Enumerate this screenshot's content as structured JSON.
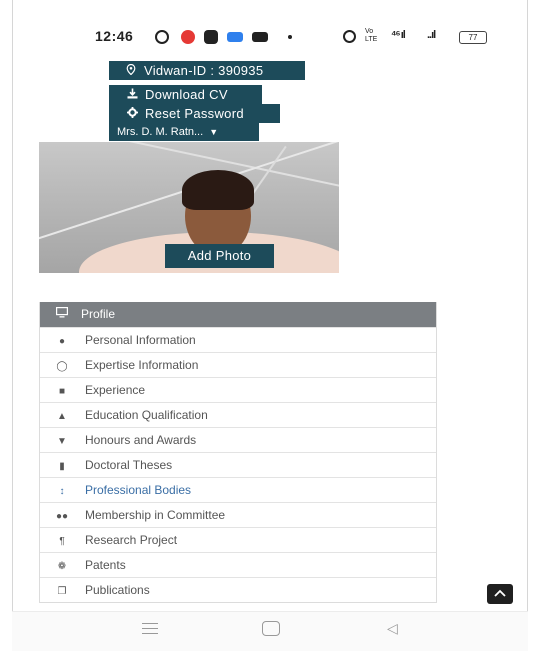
{
  "status_bar": {
    "time": "12:46",
    "vo_label": "Vo LTE",
    "signal1": "⁴⁶ ıl",
    "signal2": "..ıl",
    "battery": "77"
  },
  "profile": {
    "vidwan_id": "Vidwan-ID : 390935",
    "download_cv": "Download CV",
    "reset_password": "Reset Password",
    "user_name": "Mrs. D. M. Ratn...",
    "add_photo": "Add Photo"
  },
  "menu": {
    "header": "Profile",
    "items": [
      {
        "label": "Personal Information",
        "icon": "person-icon"
      },
      {
        "label": "Expertise Information",
        "icon": "lightbulb-icon"
      },
      {
        "label": "Experience",
        "icon": "briefcase-icon"
      },
      {
        "label": "Education Qualification",
        "icon": "graduation-cap-icon"
      },
      {
        "label": "Honours and Awards",
        "icon": "trophy-icon"
      },
      {
        "label": "Doctoral Theses",
        "icon": "book-icon"
      },
      {
        "label": "Professional Bodies",
        "icon": "sort-icon"
      },
      {
        "label": "Membership in Committee",
        "icon": "group-icon"
      },
      {
        "label": "Research Project",
        "icon": "paragraph-icon"
      },
      {
        "label": "Patents",
        "icon": "gears-icon"
      },
      {
        "label": "Publications",
        "icon": "copy-icon"
      }
    ]
  },
  "colors": {
    "teal": "#1d4b5a",
    "menu_header": "#7b7f83",
    "active_link": "#3a6ea5"
  }
}
